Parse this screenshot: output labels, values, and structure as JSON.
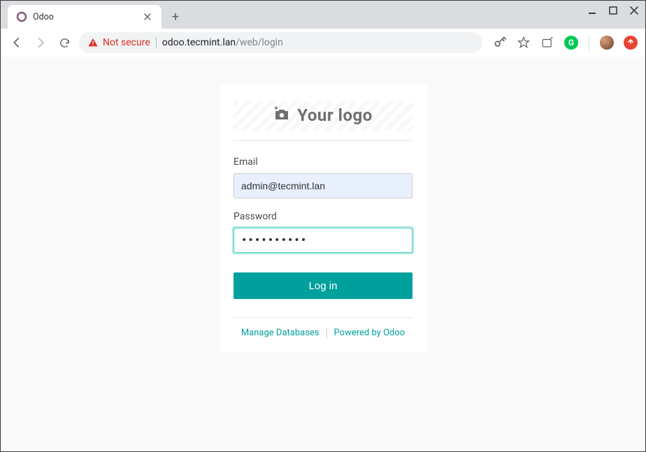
{
  "browser": {
    "tab": {
      "title": "Odoo"
    },
    "security_label": "Not secure",
    "url": {
      "host": "odoo.tecmint.lan",
      "path": "/web/login"
    }
  },
  "login": {
    "logo_text": "Your logo",
    "email_label": "Email",
    "email_value": "admin@tecmint.lan",
    "password_label": "Password",
    "password_value": "••••••••••",
    "submit_label": "Log in",
    "footer": {
      "manage_db": "Manage Databases",
      "powered_by": "Powered by Odoo"
    }
  }
}
